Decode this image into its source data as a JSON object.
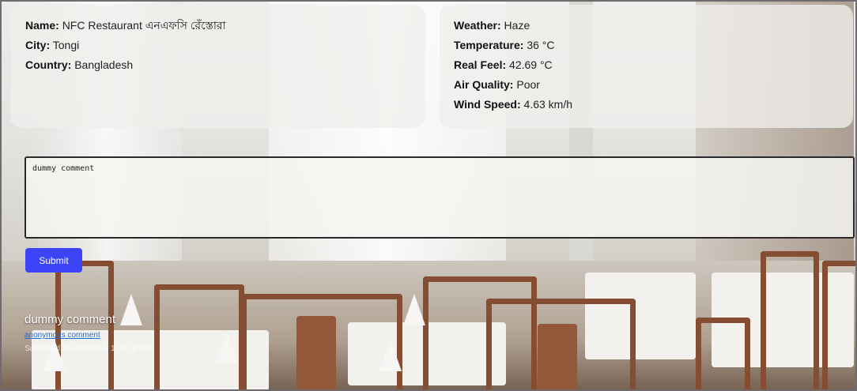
{
  "place": {
    "name_label": "Name:",
    "name_value": "NFC Restaurant এনএফসি রেঁস্তোরা",
    "city_label": "City:",
    "city_value": "Tongi",
    "country_label": "Country:",
    "country_value": "Bangladesh"
  },
  "weather": {
    "weather_label": "Weather:",
    "weather_value": "Haze",
    "temperature_label": "Temperature:",
    "temperature_value": "36 °C",
    "realfeel_label": "Real Feel:",
    "realfeel_value": "42.69 °C",
    "airquality_label": "Air Quality:",
    "airquality_value": "Poor",
    "windspeed_label": "Wind Speed:",
    "windspeed_value": "4.63 km/h"
  },
  "comment_form": {
    "value": "dummy comment",
    "submit_label": "Submit"
  },
  "comments": [
    {
      "text": "dummy comment",
      "author": "anonymous comment",
      "submitted": "Submitted at 4/27/2024, 1:16:18 PM"
    }
  ],
  "colors": {
    "submit_button": "#3b44f6",
    "author_link": "#1f6fd8"
  }
}
